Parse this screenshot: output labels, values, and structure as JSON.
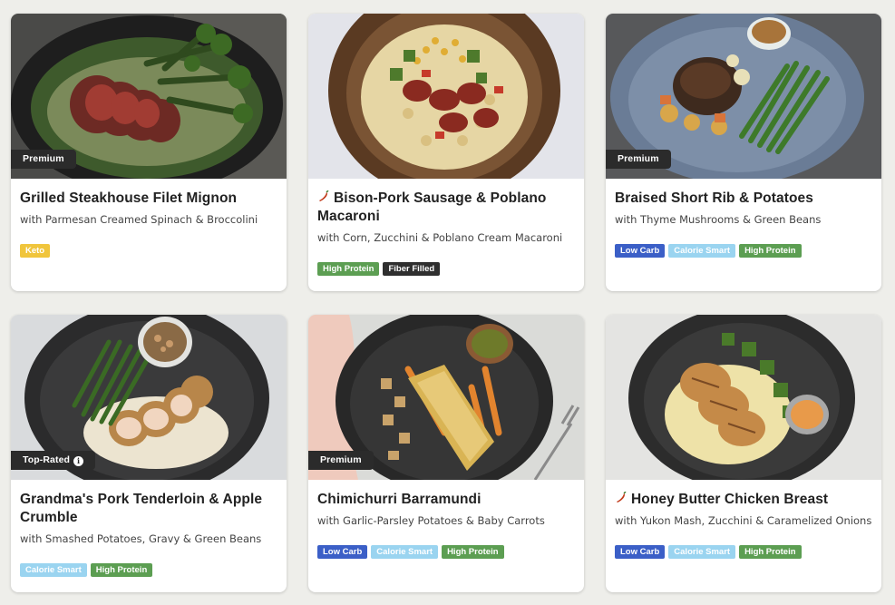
{
  "colors": {
    "keto": "#f0c53c",
    "low_carb": "#3b5fc7",
    "calorie_smart": "#9ad4f0",
    "high_protein": "#5c9e52",
    "fiber_filled": "#2f2f2f",
    "ribbon": "#2b2b2b",
    "spicy": "#c23a1a"
  },
  "meals": [
    {
      "badge": "Premium",
      "title": "Grilled Steakhouse Filet Mignon",
      "subtitle": "with Parmesan Creamed Spinach & Broccolini",
      "spicy": false,
      "tags": [
        {
          "label": "Keto",
          "kind": "keto"
        }
      ]
    },
    {
      "badge": "",
      "title": "Bison-Pork Sausage & Poblano Macaroni",
      "subtitle": "with Corn, Zucchini & Poblano Cream Macaroni",
      "spicy": true,
      "tags": [
        {
          "label": "High Protein",
          "kind": "high_protein"
        },
        {
          "label": "Fiber Filled",
          "kind": "fiber_filled"
        }
      ]
    },
    {
      "badge": "Premium",
      "title": "Braised Short Rib & Potatoes",
      "subtitle": "with Thyme Mushrooms & Green Beans",
      "spicy": false,
      "tags": [
        {
          "label": "Low Carb",
          "kind": "low_carb"
        },
        {
          "label": "Calorie Smart",
          "kind": "calorie_smart"
        },
        {
          "label": "High Protein",
          "kind": "high_protein"
        }
      ]
    },
    {
      "badge": "Top-Rated",
      "badge_icon": "i",
      "title": "Grandma's Pork Tenderloin & Apple Crumble",
      "subtitle": "with Smashed Potatoes, Gravy & Green Beans",
      "spicy": false,
      "tags": [
        {
          "label": "Calorie Smart",
          "kind": "calorie_smart"
        },
        {
          "label": "High Protein",
          "kind": "high_protein"
        }
      ]
    },
    {
      "badge": "Premium",
      "title": "Chimichurri Barramundi",
      "subtitle": "with Garlic-Parsley Potatoes & Baby Carrots",
      "spicy": false,
      "tags": [
        {
          "label": "Low Carb",
          "kind": "low_carb"
        },
        {
          "label": "Calorie Smart",
          "kind": "calorie_smart"
        },
        {
          "label": "High Protein",
          "kind": "high_protein"
        }
      ]
    },
    {
      "badge": "",
      "title": "Honey Butter Chicken Breast",
      "subtitle": "with Yukon Mash, Zucchini & Caramelized Onions",
      "spicy": true,
      "tags": [
        {
          "label": "Low Carb",
          "kind": "low_carb"
        },
        {
          "label": "Calorie Smart",
          "kind": "calorie_smart"
        },
        {
          "label": "High Protein",
          "kind": "high_protein"
        }
      ]
    }
  ]
}
